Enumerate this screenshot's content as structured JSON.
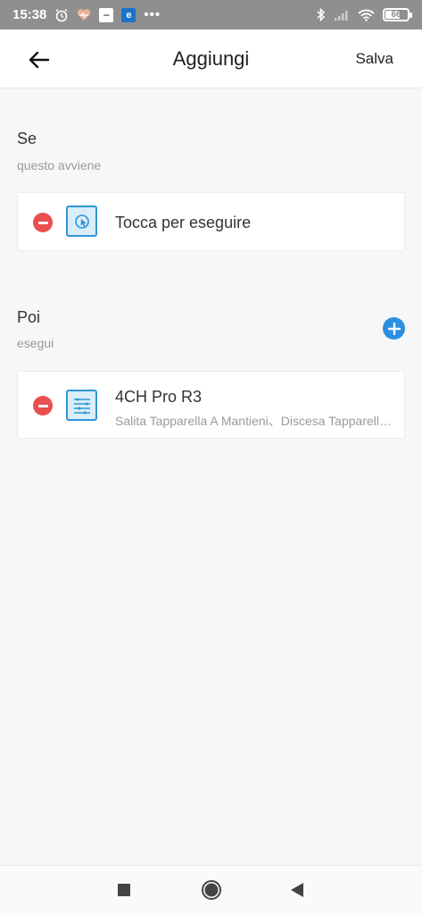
{
  "status_bar": {
    "time": "15:38",
    "battery": "66",
    "battery_level_percent": 66,
    "icons": [
      "alarm-icon",
      "heart-icon",
      "app-icon",
      "edge-icon",
      "more-dots-icon",
      "bluetooth-icon",
      "signal-icon",
      "wifi-icon",
      "battery-icon"
    ]
  },
  "header": {
    "title": "Aggiungi",
    "save_label": "Salva",
    "back_icon": "arrow-left-icon"
  },
  "if_section": {
    "title": "Se",
    "subtitle": "questo avviene",
    "condition": {
      "label": "Tocca per eseguire",
      "icon": "tap-to-run-icon"
    }
  },
  "then_section": {
    "title": "Poi",
    "subtitle": "esegui",
    "add_icon": "add-circle-icon",
    "action": {
      "title": "4CH Pro R3",
      "subtitle": "Salita Tapparella A Mantieni、Discesa Tapparella A Mantieni",
      "icon": "device-4ch-icon"
    }
  },
  "nav_bar": {
    "icons": [
      "recent-apps-icon",
      "home-icon",
      "back-icon"
    ]
  },
  "colors": {
    "accent": "#2a8fe0",
    "remove": "#e94f4f",
    "status_bar": "#8f8f8f",
    "background": "#f7f7f7"
  }
}
